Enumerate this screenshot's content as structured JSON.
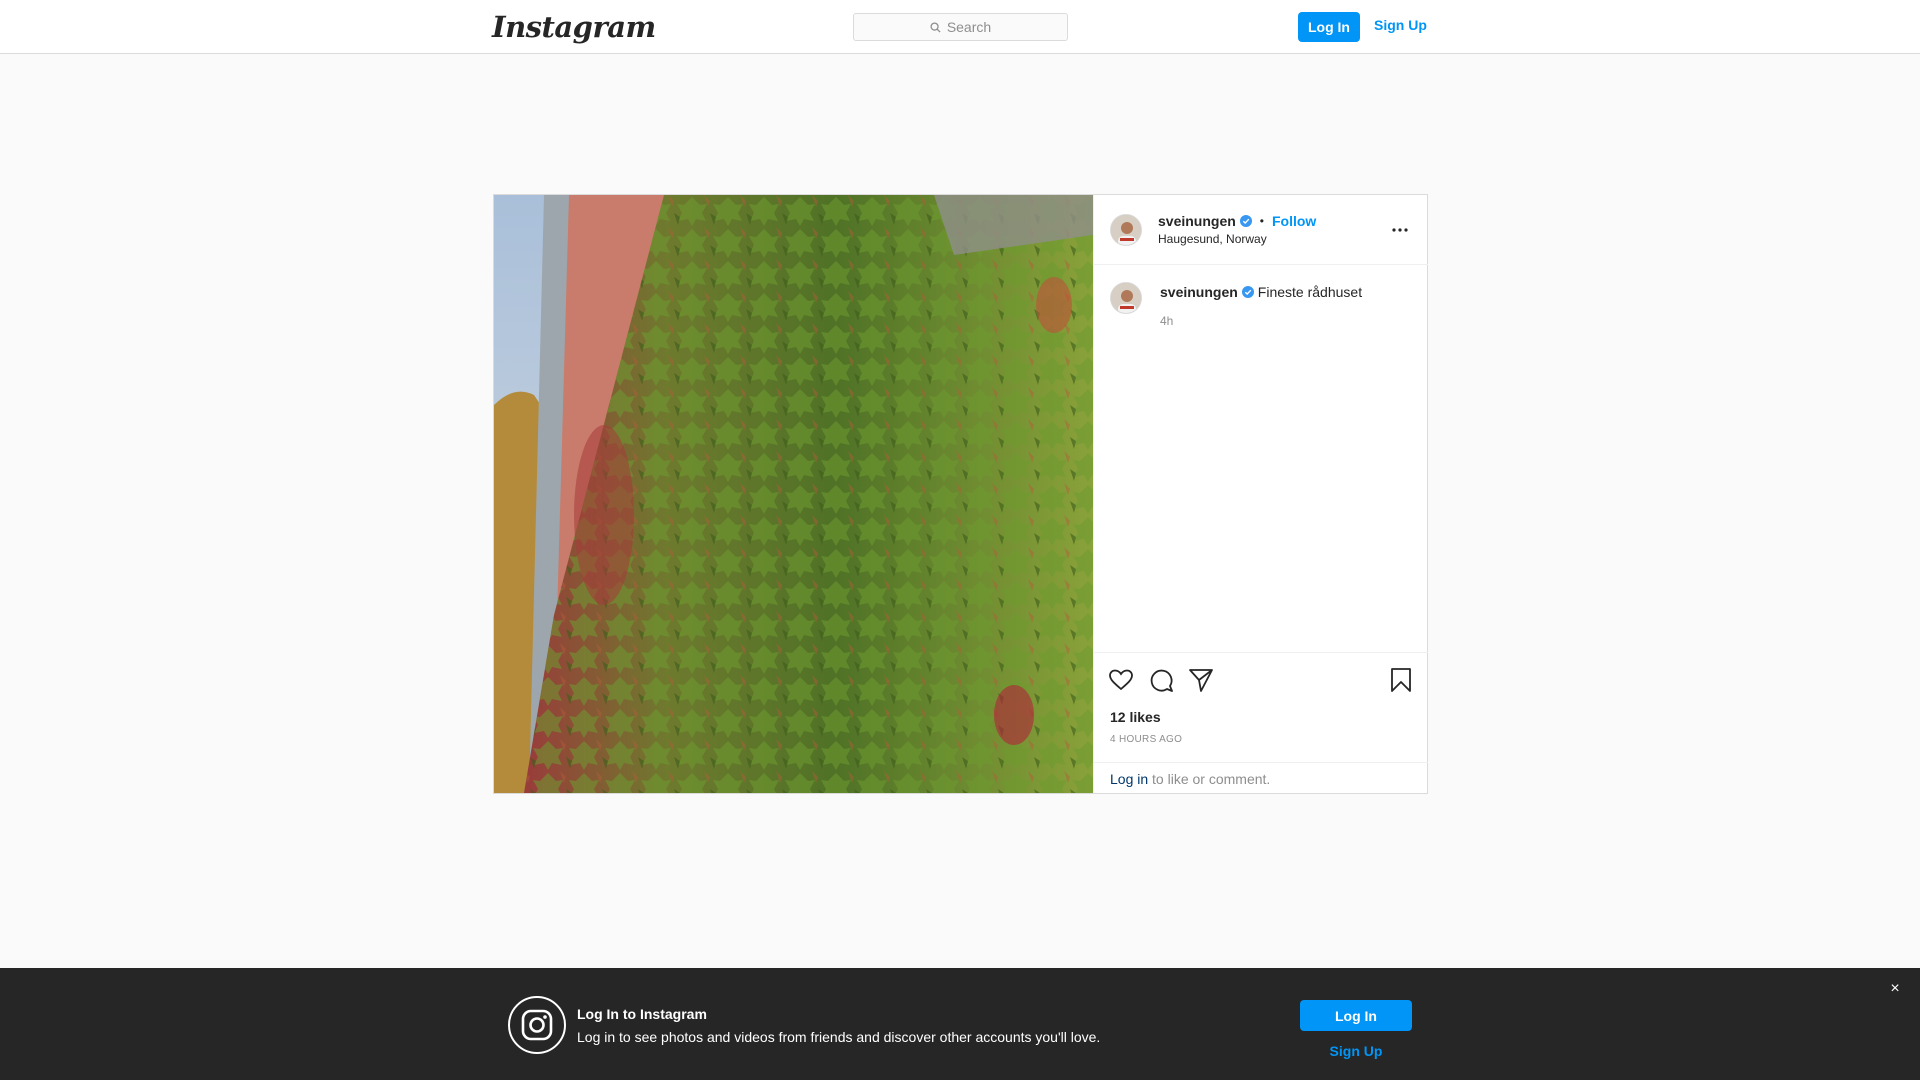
{
  "nav": {
    "logo_text": "Instagram",
    "search_placeholder": "Search",
    "login_label": "Log In",
    "signup_label": "Sign Up"
  },
  "post": {
    "header": {
      "username": "sveinungen",
      "verified": true,
      "separator": "•",
      "follow_label": "Follow",
      "location": "Haugesund, Norway",
      "more_icon": "more-horizontal-icon"
    },
    "caption": {
      "username": "sveinungen",
      "text": "Fineste rådhuset",
      "time": "4h"
    },
    "likes": "12 likes",
    "time_ago": "4 HOURS AGO",
    "login_prompt": {
      "link_text": "Log in",
      "rest_text": "to like or comment."
    }
  },
  "banner": {
    "title": "Log In to Instagram",
    "subtitle": "Log in to see photos and videos from friends and discover other accounts you'll love.",
    "login_label": "Log In",
    "signup_label": "Sign Up",
    "close_glyph": "×"
  },
  "colors": {
    "accent": "#0095f6",
    "verified": "#3897f0",
    "banner_bg": "#262626",
    "border": "#dbdbdb"
  }
}
